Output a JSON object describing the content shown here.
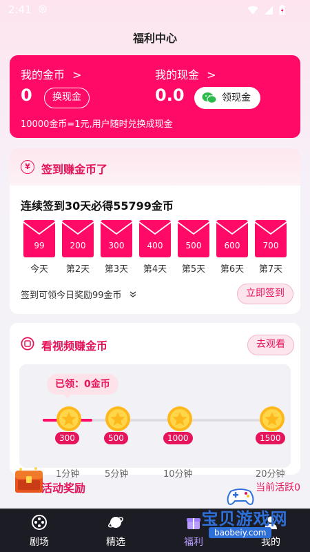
{
  "status_bar": {
    "time": "2:41"
  },
  "header": {
    "title": "福利中心"
  },
  "wallet": {
    "coins_label": "我的金币",
    "coins_value": "0",
    "exchange_button": "换现金",
    "cash_label": "我的现金",
    "cash_value": "0.0",
    "withdraw_button": "领现金",
    "note": "10000金币=1元,用户随时兑换成现金",
    "chevron": ">"
  },
  "checkin": {
    "title": "签到赚金币了",
    "subtitle": "连续签到30天必得55799金币",
    "days": [
      {
        "amount": "99",
        "label": "今天"
      },
      {
        "amount": "200",
        "label": "第2天"
      },
      {
        "amount": "300",
        "label": "第3天"
      },
      {
        "amount": "400",
        "label": "第4天"
      },
      {
        "amount": "500",
        "label": "第5天"
      },
      {
        "amount": "600",
        "label": "第6天"
      },
      {
        "amount": "700",
        "label": "第7天"
      }
    ],
    "reward_note": "签到可领今日奖励99金币",
    "button": "立即签到",
    "icon_text": "¥"
  },
  "video": {
    "title": "看视频赚金币",
    "button": "去观看",
    "earned": "已领：0金币",
    "progress_fraction": 0.07,
    "milestones": [
      {
        "coins": "300",
        "time": "1分钟"
      },
      {
        "coins": "500",
        "time": "5分钟"
      },
      {
        "coins": "1000",
        "time": "10分钟"
      },
      {
        "coins": "1500",
        "time": "20分钟"
      }
    ]
  },
  "activity": {
    "title": "活动奖励",
    "status": "当前活跃0"
  },
  "nav": {
    "items": [
      {
        "label": "剧场",
        "icon": "film-reel-icon"
      },
      {
        "label": "精选",
        "icon": "planet-icon"
      },
      {
        "label": "福利",
        "icon": "gift-icon"
      },
      {
        "label": "我的",
        "icon": "profile-icon"
      }
    ]
  },
  "watermark": {
    "text": "宝贝游戏网",
    "url": "baobeiy.com"
  },
  "colors": {
    "accent": "#ff0a66",
    "accent_dark": "#e6145a",
    "nav_bg": "#1c1c24",
    "active_nav": "#b89cff"
  }
}
